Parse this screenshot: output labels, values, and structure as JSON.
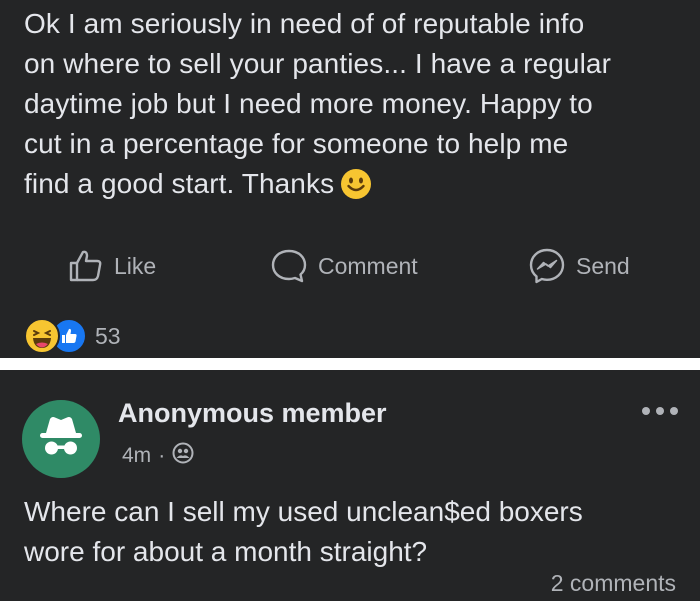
{
  "post1": {
    "lines": [
      "Ok I am seriously in need of of reputable info",
      "on where to sell your panties... I have a regular",
      "daytime job but I need more money. Happy to",
      "cut in a percentage for someone to help me",
      "find a good start. Thanks"
    ],
    "emoji": "smiley-emoji",
    "actions": {
      "like": "Like",
      "comment": "Comment",
      "send": "Send"
    },
    "reactions": {
      "icons": [
        "haha-reaction-icon",
        "like-reaction-icon"
      ],
      "count": "53"
    }
  },
  "post2": {
    "author": "Anonymous member",
    "time": "4m",
    "separator": "·",
    "privacy_icon": "group-privacy-icon",
    "avatar_icon": "anonymous-spy-icon",
    "lines": [
      "Where can I sell my used unclean$ed boxers",
      "wore for about a month straight?"
    ],
    "comments": "2 comments"
  },
  "colors": {
    "background": "#242526",
    "text": "#e4e6eb",
    "secondary": "#b0b3b8",
    "avatar": "#2f8a66",
    "like_blue": "#1877f2",
    "haha_yellow": "#f7c531"
  }
}
